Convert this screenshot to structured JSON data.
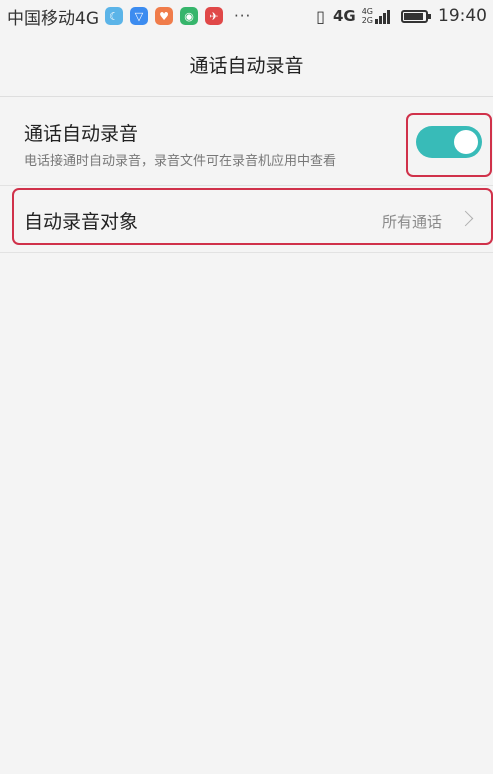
{
  "status_bar": {
    "carrier": "中国移动4G",
    "app_icons": [
      {
        "name": "moon-app-icon",
        "color": "#5bb4e8",
        "glyph": "☾"
      },
      {
        "name": "shield-app-icon",
        "color": "#3c8cf0",
        "glyph": "▽"
      },
      {
        "name": "heart-app-icon",
        "color": "#f07c4a",
        "glyph": "♥"
      },
      {
        "name": "eye-app-icon",
        "color": "#36b56b",
        "glyph": "◉"
      },
      {
        "name": "plane-app-icon",
        "color": "#e04848",
        "glyph": "✈"
      }
    ],
    "more": "···",
    "network": "4G",
    "network_top": "4G",
    "network_bottom": "2G",
    "time": "19:40"
  },
  "header": {
    "title": "通话自动录音"
  },
  "settings": {
    "auto_record": {
      "title": "通话自动录音",
      "subtitle": "电话接通时自动录音，录音文件可在录音机应用中查看",
      "enabled": true
    },
    "record_target": {
      "title": "自动录音对象",
      "value": "所有通话"
    }
  },
  "colors": {
    "accent": "#38bbb8",
    "highlight": "#d0314a"
  }
}
